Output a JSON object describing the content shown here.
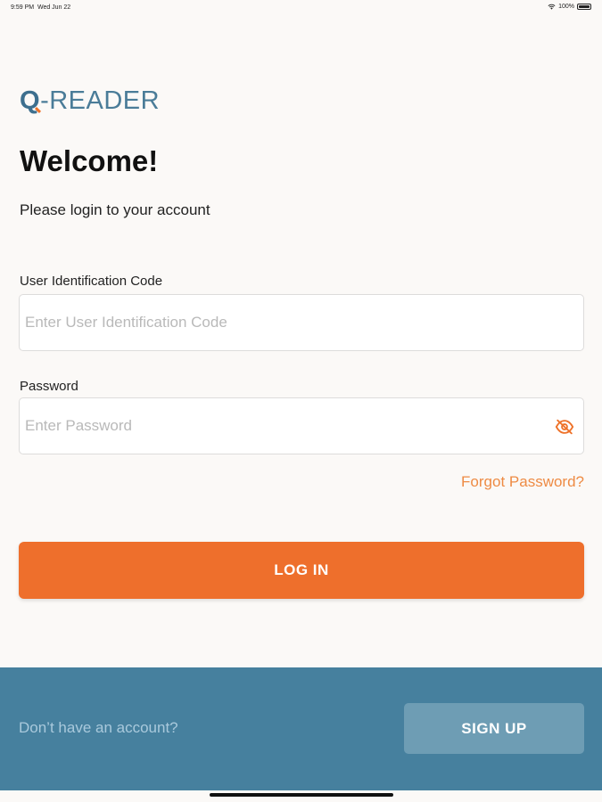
{
  "status_bar": {
    "time": "9:59 PM",
    "date": "Wed Jun 22",
    "battery": "100%",
    "wifi_icon": "wifi-icon",
    "battery_icon": "battery-icon"
  },
  "logo": {
    "q": "Q",
    "rest": "-READER"
  },
  "header": {
    "title": "Welcome!",
    "subtitle": "Please login to your account"
  },
  "form": {
    "user_code": {
      "label": "User Identification Code",
      "placeholder": "Enter User Identification Code",
      "value": ""
    },
    "password": {
      "label": "Password",
      "placeholder": "Enter Password",
      "value": "",
      "toggle_icon": "eye-off-icon"
    },
    "forgot_label": "Forgot Password?",
    "login_label": "LOG IN"
  },
  "footer": {
    "prompt": "Don’t have an account?",
    "signup_label": "SIGN UP"
  },
  "colors": {
    "accent": "#ee6f2c",
    "brand": "#46809e",
    "link": "#ee8b44"
  }
}
